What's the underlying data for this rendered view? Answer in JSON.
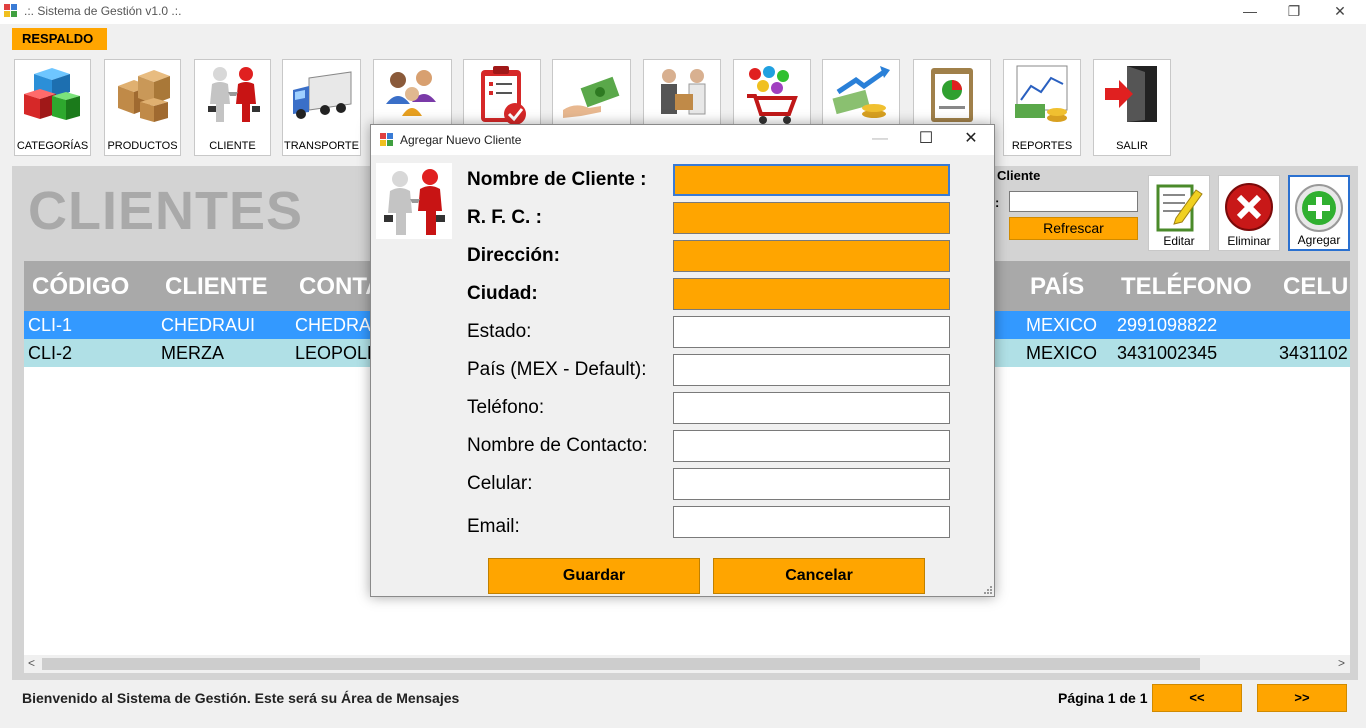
{
  "window": {
    "title": ".:. Sistema de Gestión v1.0 .:.",
    "controls": {
      "minimize": "—",
      "restore": "❐",
      "close": "✕"
    }
  },
  "menu": {
    "respaldo": "RESPALDO"
  },
  "toolbar": {
    "categorias": "CATEGORÍAS",
    "productos": "PRODUCTOS",
    "cliente": "CLIENTE",
    "transporte": "TRANSPORTE",
    "reportes": "REPORTES",
    "salir": "SALIR"
  },
  "page": {
    "title": "CLIENTES"
  },
  "search": {
    "label": "Cliente",
    "colon": ":",
    "value": "",
    "refresh_label": "Refrescar"
  },
  "actions": {
    "editar": "Editar",
    "eliminar": "Eliminar",
    "agregar": "Agregar"
  },
  "table": {
    "columns": [
      "CÓDIGO",
      "CLIENTE",
      "CONTA",
      "PAÍS",
      "TELÉFONO",
      "CELUL"
    ],
    "rows": [
      {
        "codigo": "CLI-1",
        "cliente": "CHEDRAUI",
        "contacto": "CHEDRAU",
        "pais": "MEXICO",
        "telefono": "2991098822",
        "celular": "",
        "selected": true
      },
      {
        "codigo": "CLI-2",
        "cliente": "MERZA",
        "contacto": "LEOPOLD",
        "pais": "MEXICO",
        "telefono": "3431002345",
        "celular": "3431102",
        "selected": false
      }
    ]
  },
  "scroll": {
    "left": "<",
    "right": ">"
  },
  "status": {
    "message": "Bienvenido al Sistema de Gestión. Este será su Área de Mensajes",
    "page_label": "Página 1 de 1",
    "prev_label": "<<",
    "next_label": ">>"
  },
  "dialog": {
    "title": "Agregar Nuevo Cliente",
    "controls": {
      "minimize": "—",
      "maximize": "☐",
      "close": "✕"
    },
    "fields": [
      {
        "label": "Nombre de Cliente :",
        "value": "",
        "required": true
      },
      {
        "label": "R. F. C. :",
        "value": "",
        "required": true
      },
      {
        "label": "Dirección:",
        "value": "",
        "required": true
      },
      {
        "label": "Ciudad:",
        "value": "",
        "required": true
      },
      {
        "label": "Estado:",
        "value": "",
        "required": false
      },
      {
        "label": "País (MEX - Default):",
        "value": "",
        "required": false
      },
      {
        "label": "Teléfono:",
        "value": "",
        "required": false
      },
      {
        "label": "Nombre de Contacto:",
        "value": "",
        "required": false
      },
      {
        "label": "Celular:",
        "value": "",
        "required": false
      },
      {
        "label": "Email:",
        "value": "",
        "required": false
      }
    ],
    "guardar_label": "Guardar",
    "cancelar_label": "Cancelar"
  },
  "colors": {
    "accent": "#ffa500",
    "selected_row": "#3399ff",
    "alt_row": "#b0e0e6",
    "header": "#a9a9a9"
  }
}
